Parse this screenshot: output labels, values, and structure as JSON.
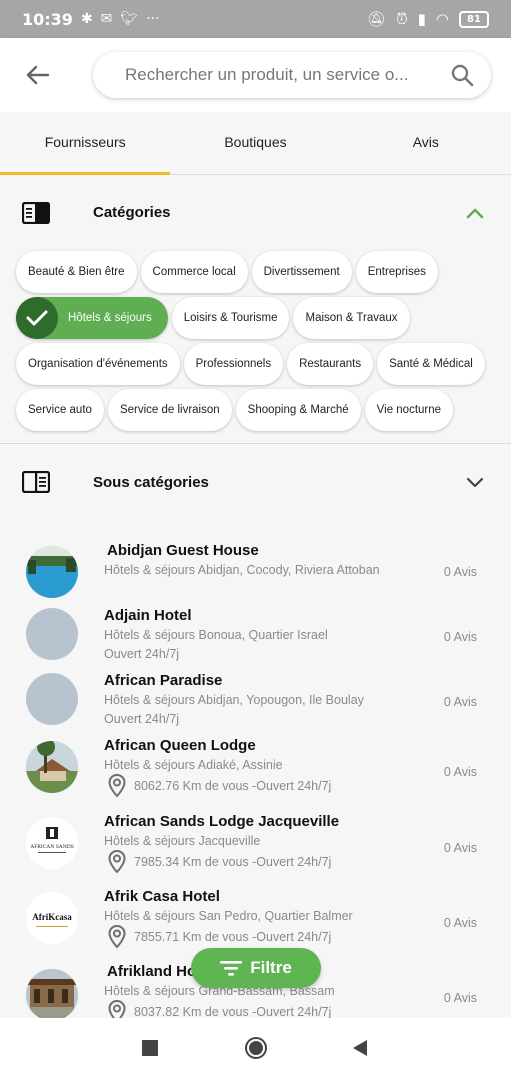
{
  "status_bar": {
    "time": "10:39",
    "left_icons": [
      "bluetooth-icon",
      "mail-icon",
      "twitter-icon",
      "more-icon"
    ],
    "right_icons": [
      "silent-icon",
      "alarm-icon",
      "signal-icon",
      "wifi-icon"
    ],
    "battery": "81"
  },
  "header": {
    "search_placeholder": "Rechercher un produit, un service o..."
  },
  "tabs": [
    {
      "label": "Fournisseurs",
      "active": true
    },
    {
      "label": "Boutiques",
      "active": false
    },
    {
      "label": "Avis",
      "active": false
    }
  ],
  "categories": {
    "title": "Catégories",
    "chips": [
      [
        "Beauté & Bien être",
        "Commerce local",
        "Divertissement",
        "Entreprises"
      ],
      [
        "Hôtels & séjours",
        "Loisirs & Tourisme",
        "Maison & Travaux"
      ],
      [
        "Organisation d'événements",
        "Professionnels",
        "Restaurants",
        "Santé & Médical"
      ],
      [
        "Service auto",
        "Service de livraison",
        "Shooping & Marché",
        "Vie nocturne"
      ]
    ],
    "selected": "Hôtels & séjours"
  },
  "subcategories": {
    "title": "Sous catégories"
  },
  "listings": [
    {
      "name": "Abidjan Guest House",
      "meta": "Hôtels & séjours Abidjan,  Cocody, Riviera Attoban",
      "extra": "",
      "distance": "",
      "avis": "0 Avis"
    },
    {
      "name": "Adjain Hotel",
      "meta": "Hôtels & séjours Bonoua,  Quartier Israel",
      "extra": "Ouvert 24h/7j",
      "distance": "",
      "avis": "0 Avis"
    },
    {
      "name": "African Paradise",
      "meta": "Hôtels & séjours Abidjan,  Yopougon, Ile Boulay",
      "extra": "Ouvert 24h/7j",
      "distance": "",
      "avis": "0 Avis"
    },
    {
      "name": "African Queen Lodge",
      "meta": "Hôtels & séjours Adiaké, Assinie",
      "extra": "",
      "distance": "8062.76 Km de vous  -Ouvert 24h/7j",
      "avis": "0 Avis"
    },
    {
      "name": "African Sands Lodge Jacqueville",
      "meta": "Hôtels & séjours Jacqueville",
      "extra": "",
      "distance": "7985.34 Km de vous  -Ouvert 24h/7j",
      "avis": "0 Avis"
    },
    {
      "name": "Afrik Casa Hotel",
      "meta": "Hôtels & séjours San Pedro,  Quartier Balmer",
      "extra": "",
      "distance": "7855.71 Km de vous  -Ouvert 24h/7j",
      "avis": "0 Avis"
    },
    {
      "name": "Afrikland Hotel",
      "meta": "Hôtels & séjours Grand-Bassam,  Bassam",
      "extra": "",
      "distance": "8037.82 Km de vous  -Ouvert 24h/7j",
      "avis": "0 Avis"
    }
  ],
  "logos": {
    "african_sands": "AFRICAN SANDS",
    "afrik_casa": "AfriKcasa"
  },
  "filter_button": {
    "label": "Filtre"
  },
  "colors": {
    "accent_green": "#5fae52",
    "tab_indicator": "#f5b82a",
    "avatar_placeholder": "#b7c4cf"
  }
}
